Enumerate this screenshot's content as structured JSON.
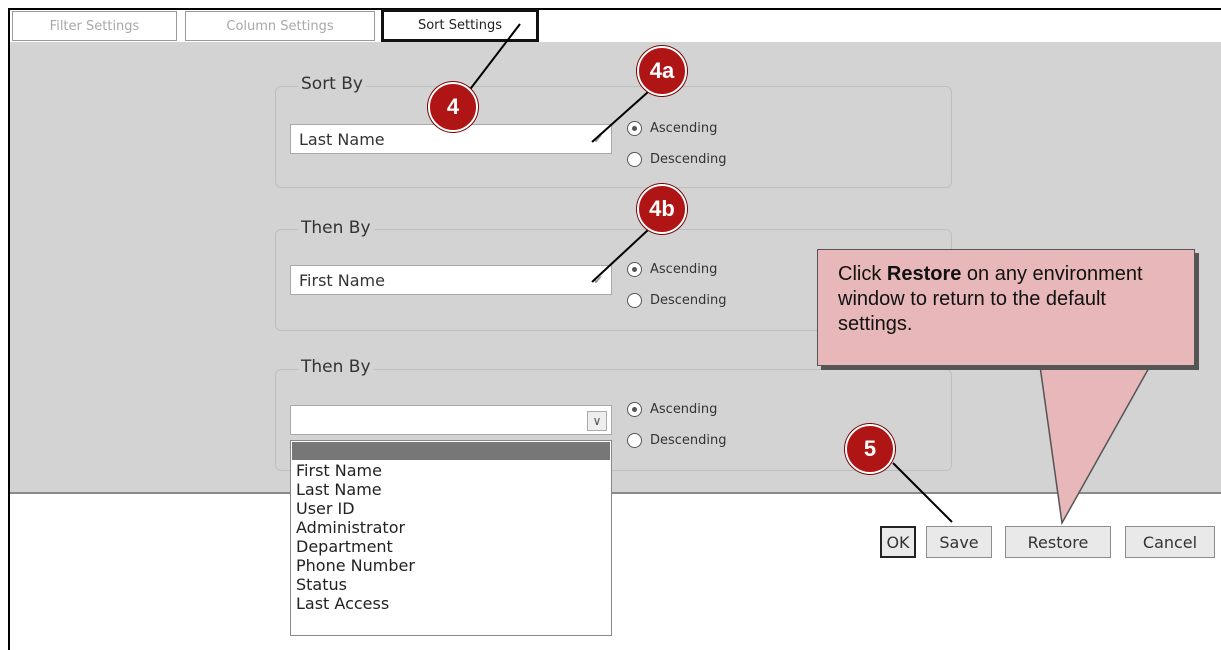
{
  "tabs": [
    {
      "label": "Filter Settings"
    },
    {
      "label": "Column Settings"
    },
    {
      "label": "Sort Settings"
    }
  ],
  "groups": [
    {
      "legend": "Sort By",
      "selected": "Last Name",
      "ascending": "Ascending",
      "descending": "Descending"
    },
    {
      "legend": "Then By",
      "selected": "First Name",
      "ascending": "Ascending",
      "descending": "Descending"
    },
    {
      "legend": "Then By",
      "selected": "",
      "ascending": "Ascending",
      "descending": "Descending"
    }
  ],
  "dropdown_options": [
    "First Name",
    "Last Name",
    "User ID",
    "Administrator",
    "Department",
    "Phone Number",
    "Status",
    "Last Access"
  ],
  "buttons": {
    "ok": "OK",
    "save": "Save",
    "restore": "Restore",
    "cancel": "Cancel"
  },
  "callout": {
    "pre": "Click ",
    "bold": "Restore",
    "post": " on any environment window to return to the default settings."
  },
  "badges": {
    "b4": "4",
    "b4a": "4a",
    "b4b": "4b",
    "b5": "5"
  },
  "icons": {
    "select_arrow": "chevron-down-icon",
    "radio": "radio-icon"
  }
}
